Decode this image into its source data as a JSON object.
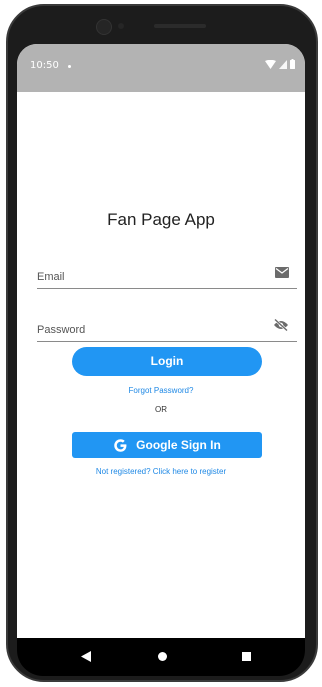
{
  "status_bar": {
    "time": "10:50"
  },
  "app": {
    "title": "Fan Page App"
  },
  "form": {
    "email_label": "Email",
    "password_label": "Password",
    "login_label": "Login",
    "forgot_password_label": "Forgot Password?",
    "or_label": "OR",
    "google_sign_in_label": "Google Sign In",
    "register_label": "Not registered? Click here to register"
  },
  "icons": {
    "email": "mail-icon",
    "password": "visibility-off-icon",
    "google": "google-g-icon"
  },
  "colors": {
    "accent": "#2196f3",
    "status_bar": "#b3b3b3",
    "link": "#1e88e5"
  }
}
